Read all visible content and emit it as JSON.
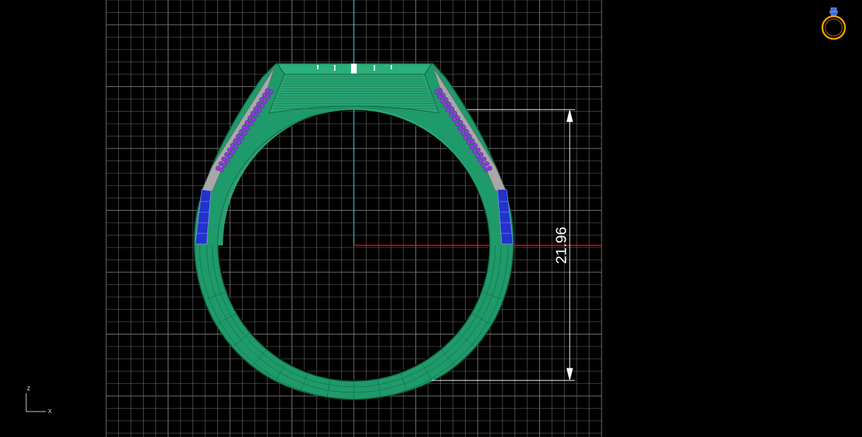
{
  "viewport": {
    "name": "front-view",
    "background": "#000000",
    "grid_color": "#8a8a8a",
    "x_axis_color": "#ff0000",
    "y_axis_color": "#33cccc"
  },
  "model": {
    "body_color": "#1f9a6a",
    "body_edge_color": "#0d5c3e",
    "metal_color": "#a8a8a8",
    "purple_stone_color": "#8a3ed8",
    "blue_stone_color": "#2233cc"
  },
  "dimension": {
    "value": "21.96",
    "color": "#ffffff"
  },
  "axis_indicator": {
    "z_label": "z",
    "x_label": "x"
  },
  "view_widget": {
    "icon": "ring-icon",
    "color": "#f0a000",
    "accent": "#3b6fd8"
  }
}
